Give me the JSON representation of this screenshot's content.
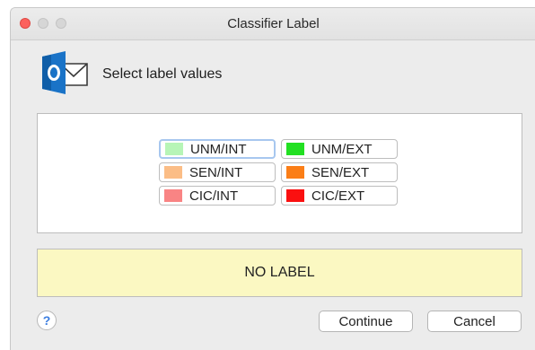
{
  "window": {
    "title": "Classifier Label"
  },
  "header": {
    "icon": "outlook-icon",
    "text": "Select label values"
  },
  "labels": [
    {
      "text": "UNM/INT",
      "color": "#b7f5b7",
      "selected": true
    },
    {
      "text": "UNM/EXT",
      "color": "#22e022",
      "selected": false
    },
    {
      "text": "SEN/INT",
      "color": "#fbbd86",
      "selected": false
    },
    {
      "text": "SEN/EXT",
      "color": "#fb7e17",
      "selected": false
    },
    {
      "text": "CIC/INT",
      "color": "#f98484",
      "selected": false
    },
    {
      "text": "CIC/EXT",
      "color": "#fa1010",
      "selected": false
    }
  ],
  "status": {
    "text": "NO LABEL",
    "background": "#fbf8c2"
  },
  "footer": {
    "help_label": "?",
    "continue_label": "Continue",
    "cancel_label": "Cancel"
  }
}
